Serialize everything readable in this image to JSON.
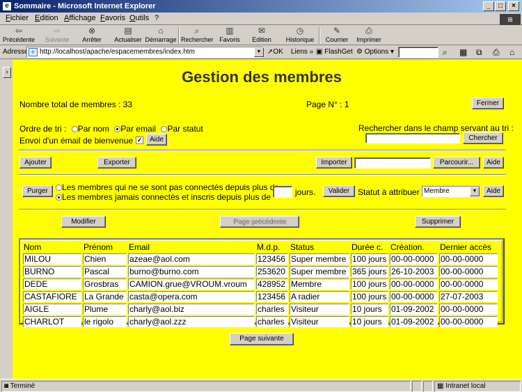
{
  "window": {
    "title": "Sommaire - Microsoft Internet Explorer",
    "controls": [
      "_",
      "□",
      "×"
    ]
  },
  "menu": [
    "Fichier",
    "Edition",
    "Affichage",
    "Favoris",
    "Outils",
    "?"
  ],
  "toolbar": {
    "back": "Précédente",
    "forward": "Suivante",
    "stop": "Arrêter",
    "refresh": "Actualiser",
    "home": "Démarrage",
    "search": "Rechercher",
    "favorites": "Favoris",
    "edit": "Edition",
    "history": "Historique",
    "mail": "Courrier",
    "print": "Imprimer"
  },
  "address": {
    "label": "Adresse",
    "url": "http://localhost/apache/espacemembres/index.htm",
    "go": "OK",
    "links": "Liens",
    "flashget": "FlashGet",
    "options": "Options"
  },
  "page": {
    "title": "Gestion des membres",
    "total_members": "Nombre total de membres : 33",
    "page_no": "Page N° : 1",
    "close_btn": "Fermer",
    "sort_label": "Ordre de tri :",
    "sort_options": [
      "Par nom",
      "Par email",
      "Par statut"
    ],
    "sort_selected": 1,
    "search_label": "Rechercher dans le champ servant au tri :",
    "search_btn": "Chercher",
    "welcome_label": "Envoi d'un émail de bienvenue :",
    "welcome_checked": true,
    "help_btn": "Aide",
    "add_btn": "Ajouter",
    "export_btn": "Exporter",
    "import_btn": "Importer",
    "browse_btn": "Parcourir...",
    "purge_btn": "Purger",
    "purge_options": [
      "Les membres qui ne se sont pas connectés depuis plus de",
      "Les membres jamais connectés et inscris depuis plus de"
    ],
    "purge_selected": 1,
    "days_label": "jours.",
    "validate_btn": "Valider",
    "status_label": "Statut à attribuer :",
    "status_value": "Membre",
    "modify_btn": "Modifier",
    "prev_btn": "Page précédente",
    "delete_btn": "Supprimer",
    "next_btn": "Page suivante"
  },
  "table": {
    "headers": [
      "Nom",
      "Prénom",
      "Email",
      "M.d.p.",
      "Status",
      "Durée c.",
      "Création.",
      "Dernier accès"
    ],
    "rows": [
      [
        "MILOU",
        "Chien",
        "azeae@aol.com",
        "123456",
        "Super membre",
        "100 jours",
        "00-00-0000",
        "00-00-0000"
      ],
      [
        "BURNO",
        "Pascal",
        "burno@burno.com",
        "253620",
        "Super membre",
        "365 jours",
        "26-10-2003",
        "00-00-0000"
      ],
      [
        "DEDE",
        "Grosbras",
        "CAMION.grue@VROUM.vroum",
        "428952",
        "Membre",
        "100 jours",
        "00-00-0000",
        "00-00-0000"
      ],
      [
        "CASTAFIORE",
        "La Grande",
        "casta@opera.com",
        "123456",
        "A radier",
        "100 jours",
        "00-00-0000",
        "27-07-2003"
      ],
      [
        "AIGLE",
        "Plume",
        "charly@aol.biz",
        "charles",
        "Visiteur",
        "10 jours",
        "01-09-2002",
        "00-00-0000"
      ],
      [
        "CHARLOT",
        "le rigolo",
        "charly@aol.zzz",
        "charles",
        "Visiteur",
        "10 jours",
        "01-09-2002",
        "00-00-0000"
      ]
    ]
  },
  "status": {
    "text": "Terminé",
    "zone": "Intranet local"
  }
}
